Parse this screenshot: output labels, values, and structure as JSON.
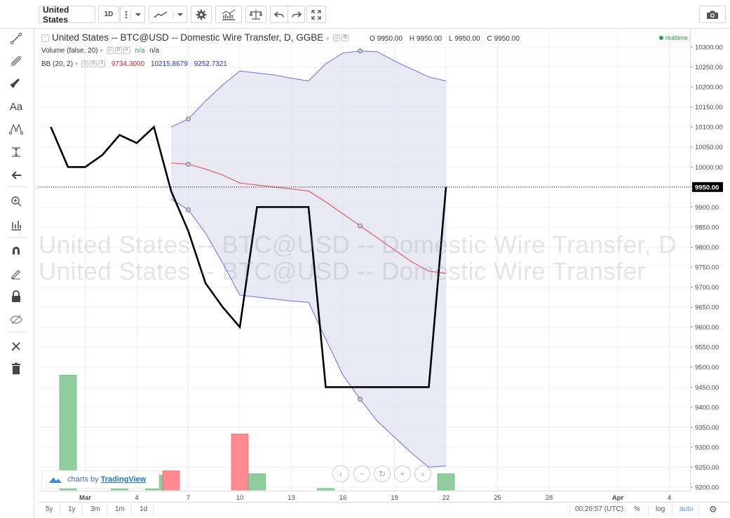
{
  "toolbar": {
    "symbol": "United States",
    "interval": "1D"
  },
  "legend": {
    "title": "United States -- BTC@USD -- Domestic Wire Transfer, D, GGBE",
    "ohlc": [
      {
        "k": "O",
        "v": "9950.00"
      },
      {
        "k": "H",
        "v": "9950.00"
      },
      {
        "k": "L",
        "v": "9950.00"
      },
      {
        "k": "C",
        "v": "9950.00"
      }
    ],
    "realtime": "realtime",
    "volume_label": "Volume (false, 20)",
    "volume_v1": "n/a",
    "volume_v2": "n/a",
    "bb_label": "BB (20, 2)",
    "bb_basis": "9734.3000",
    "bb_upper": "10215.8679",
    "bb_lower": "9252.7321"
  },
  "watermark": {
    "line1": "United States -- BTC@USD -- Domestic Wire Transfer, D",
    "line2": "United States -- BTC@USD -- Domestic Wire Transfer"
  },
  "branding": {
    "prefix": "charts by",
    "name": "TradingView"
  },
  "bottom": {
    "ranges": [
      "5y",
      "1y",
      "3m",
      "1m",
      "1d"
    ],
    "clock": "00:26:57 (UTC)",
    "percent": "%",
    "log": "log",
    "auto": "auto"
  },
  "colors": {
    "price_line": "#000000",
    "bb_upper": "#6b6bea",
    "bb_lower": "#6b6bea",
    "bb_basis": "#e3454f",
    "bb_fill": "#e2e2f0",
    "vol_up": "#8fcc9e",
    "vol_down": "#ff8a8f",
    "current_price_bg": "#000000"
  },
  "chart_data": {
    "type": "line",
    "symbol": "BTC@USD",
    "current_price": 9950.0,
    "current_price_label": "9950.00",
    "x_ticks": [
      "Mar",
      "4",
      "7",
      "10",
      "13",
      "16",
      "19",
      "22",
      "25",
      "28",
      "Apr",
      "4"
    ],
    "x_tick_day": [
      1,
      4,
      7,
      10,
      13,
      16,
      19,
      22,
      25,
      28,
      32,
      35
    ],
    "y_ticks": [
      9200,
      9250,
      9300,
      9350,
      9400,
      9450,
      9500,
      9550,
      9600,
      9650,
      9700,
      9750,
      9800,
      9850,
      9900,
      9950,
      10000,
      10050,
      10100,
      10150,
      10200,
      10250,
      10300
    ],
    "y_range": [
      9190,
      10320
    ],
    "price": {
      "day": [
        -1,
        0,
        1,
        2,
        3,
        4,
        5,
        6,
        7,
        8,
        9,
        10,
        11,
        12,
        13,
        14,
        15,
        16,
        17,
        18,
        19,
        20,
        21,
        22
      ],
      "close": [
        10100,
        10000,
        10000,
        10030,
        10080,
        10060,
        10100,
        9940,
        9840,
        9710,
        9650,
        9600,
        9900,
        9900,
        9900,
        9900,
        9450,
        9450,
        9450,
        9450,
        9450,
        9450,
        9450,
        9950
      ]
    },
    "bollinger": {
      "day": [
        6,
        7,
        8,
        9,
        10,
        11,
        12,
        13,
        14,
        15,
        16,
        17,
        18,
        19,
        20,
        21,
        22
      ],
      "upper": [
        10100,
        10120,
        10165,
        10205,
        10240,
        10235,
        10230,
        10222,
        10215,
        10258,
        10285,
        10290,
        10288,
        10265,
        10245,
        10225,
        10215
      ],
      "basis": [
        10010,
        10007,
        9995,
        9980,
        9960,
        9955,
        9950,
        9945,
        9940,
        9913,
        9883,
        9853,
        9823,
        9793,
        9763,
        9740,
        9734
      ],
      "lower": [
        9920,
        9893,
        9835,
        9760,
        9680,
        9675,
        9670,
        9665,
        9662,
        9570,
        9480,
        9420,
        9365,
        9325,
        9285,
        9250,
        9253
      ],
      "markers_day": [
        7,
        17
      ]
    },
    "volume": {
      "day": [
        0,
        3,
        5,
        6,
        10,
        11,
        15,
        22
      ],
      "value": [
        0.78,
        0.02,
        0.1,
        0.13,
        0.38,
        0.11,
        0.01,
        0.11
      ],
      "dir": [
        "up",
        "up",
        "up",
        "down",
        "down",
        "up",
        "up",
        "up"
      ]
    }
  }
}
